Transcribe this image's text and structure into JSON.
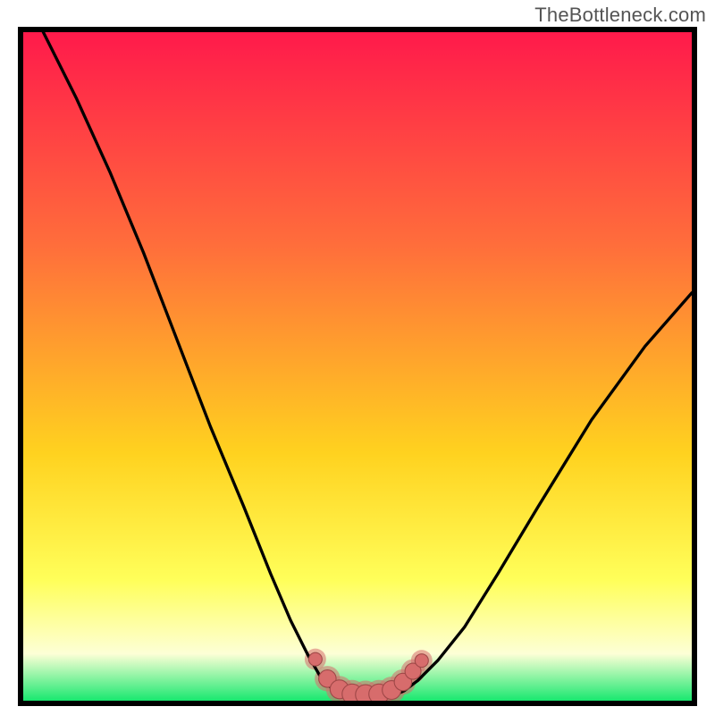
{
  "attribution": "TheBottleneck.com",
  "colors": {
    "gradient_top": "#ff1a4b",
    "gradient_mid1": "#ff6e3b",
    "gradient_mid2": "#ffd21f",
    "gradient_mid3": "#ffff5a",
    "gradient_mid4": "#fdffd6",
    "gradient_bottom": "#19e86f",
    "curve": "#000000",
    "marker_fill": "#d76c6c",
    "marker_stroke": "#a04848",
    "frame": "#000000"
  },
  "chart_data": {
    "type": "line",
    "title": "",
    "xlabel": "",
    "ylabel": "",
    "x_range": [
      0,
      100
    ],
    "y_range": [
      0,
      100
    ],
    "curve_left": [
      {
        "x": 3,
        "y": 100
      },
      {
        "x": 8,
        "y": 90
      },
      {
        "x": 13,
        "y": 79
      },
      {
        "x": 18,
        "y": 67
      },
      {
        "x": 23,
        "y": 54
      },
      {
        "x": 28,
        "y": 41
      },
      {
        "x": 33,
        "y": 29
      },
      {
        "x": 37,
        "y": 19
      },
      {
        "x": 40,
        "y": 12
      },
      {
        "x": 42.5,
        "y": 7
      },
      {
        "x": 44.5,
        "y": 3.5
      },
      {
        "x": 46.5,
        "y": 1.5
      },
      {
        "x": 49,
        "y": 0.6
      }
    ],
    "curve_right": [
      {
        "x": 55,
        "y": 0.6
      },
      {
        "x": 57,
        "y": 1.5
      },
      {
        "x": 59,
        "y": 3
      },
      {
        "x": 62,
        "y": 6
      },
      {
        "x": 66,
        "y": 11
      },
      {
        "x": 71,
        "y": 19
      },
      {
        "x": 77,
        "y": 29
      },
      {
        "x": 85,
        "y": 42
      },
      {
        "x": 93,
        "y": 53
      },
      {
        "x": 100,
        "y": 61
      }
    ],
    "floor": {
      "from_x": 49,
      "to_x": 55,
      "y": 0.6
    },
    "markers": [
      {
        "x": 43.7,
        "y": 6.2,
        "r": 1.0
      },
      {
        "x": 45.5,
        "y": 3.3,
        "r": 1.3
      },
      {
        "x": 47.3,
        "y": 1.7,
        "r": 1.4
      },
      {
        "x": 49.2,
        "y": 1.0,
        "r": 1.5
      },
      {
        "x": 51.2,
        "y": 0.9,
        "r": 1.5
      },
      {
        "x": 53.2,
        "y": 1.0,
        "r": 1.5
      },
      {
        "x": 55.1,
        "y": 1.6,
        "r": 1.4
      },
      {
        "x": 56.8,
        "y": 2.8,
        "r": 1.3
      },
      {
        "x": 58.3,
        "y": 4.4,
        "r": 1.2
      },
      {
        "x": 59.6,
        "y": 6.0,
        "r": 1.0
      }
    ]
  }
}
